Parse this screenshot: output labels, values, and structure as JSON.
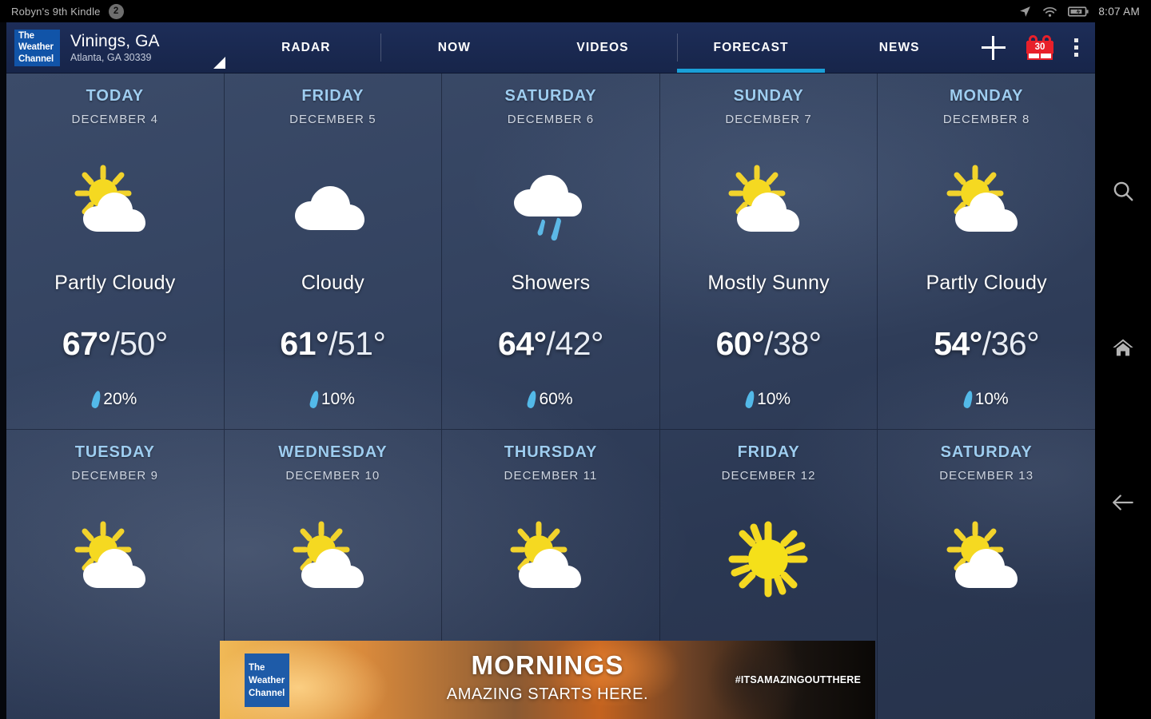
{
  "statusbar": {
    "device": "Robyn's 9th Kindle",
    "notification_count": "2",
    "time": "8:07 AM",
    "icons": [
      "location-arrow-icon",
      "wifi-icon",
      "battery-charging-icon"
    ]
  },
  "appbar": {
    "logo_line1": "The",
    "logo_line2": "Weather",
    "logo_line3": "Channel",
    "location_city": "Vinings, GA",
    "location_sub": "Atlanta, GA 30339",
    "tabs": [
      {
        "label": "RADAR",
        "active": false
      },
      {
        "label": "NOW",
        "active": false
      },
      {
        "label": "VIDEOS",
        "active": false
      },
      {
        "label": "FORECAST",
        "active": true
      },
      {
        "label": "NEWS",
        "active": false
      }
    ],
    "add_label": "+",
    "gift_badge": "30",
    "accent_color": "#1aa0d8",
    "header_color": "#1d2d58",
    "badge_color": "#e8202a"
  },
  "forecast": {
    "days": [
      {
        "day": "TODAY",
        "date": "DECEMBER 4",
        "icon": "partly-cloudy-icon",
        "condition": "Partly Cloudy",
        "high": "67°",
        "sep": "/",
        "low": "50°",
        "precip": "20%"
      },
      {
        "day": "FRIDAY",
        "date": "DECEMBER 5",
        "icon": "cloudy-icon",
        "condition": "Cloudy",
        "high": "61°",
        "sep": "/",
        "low": "51°",
        "precip": "10%"
      },
      {
        "day": "SATURDAY",
        "date": "DECEMBER 6",
        "icon": "showers-icon",
        "condition": "Showers",
        "high": "64°",
        "sep": "/",
        "low": "42°",
        "precip": "60%"
      },
      {
        "day": "SUNDAY",
        "date": "DECEMBER 7",
        "icon": "mostly-sunny-icon",
        "condition": "Mostly Sunny",
        "high": "60°",
        "sep": "/",
        "low": "38°",
        "precip": "10%"
      },
      {
        "day": "MONDAY",
        "date": "DECEMBER 8",
        "icon": "partly-cloudy-icon",
        "condition": "Partly Cloudy",
        "high": "54°",
        "sep": "/",
        "low": "36°",
        "precip": "10%"
      },
      {
        "day": "TUESDAY",
        "date": "DECEMBER 9",
        "icon": "partly-cloudy-icon",
        "condition": "",
        "high": "",
        "sep": "",
        "low": "",
        "precip": ""
      },
      {
        "day": "WEDNESDAY",
        "date": "DECEMBER 10",
        "icon": "partly-cloudy-icon",
        "condition": "",
        "high": "",
        "sep": "",
        "low": "",
        "precip": ""
      },
      {
        "day": "THURSDAY",
        "date": "DECEMBER 11",
        "icon": "partly-cloudy-icon",
        "condition": "",
        "high": "",
        "sep": "",
        "low": "",
        "precip": ""
      },
      {
        "day": "FRIDAY",
        "date": "DECEMBER 12",
        "icon": "sunny-icon",
        "condition": "",
        "high": "",
        "sep": "",
        "low": "",
        "precip": ""
      },
      {
        "day": "SATURDAY",
        "date": "DECEMBER 13",
        "icon": "partly-cloudy-icon",
        "condition": "",
        "high": "",
        "sep": "",
        "low": "",
        "precip": ""
      }
    ]
  },
  "ad": {
    "logo_line1": "The",
    "logo_line2": "Weather",
    "logo_line3": "Channel",
    "title": "MORNINGS",
    "subtitle": "AMAZING STARTS HERE.",
    "hashtag": "#ITSAMAZINGOUTTHERE"
  },
  "navbar": {
    "icons": [
      "search-icon",
      "home-icon",
      "back-arrow-icon"
    ]
  }
}
